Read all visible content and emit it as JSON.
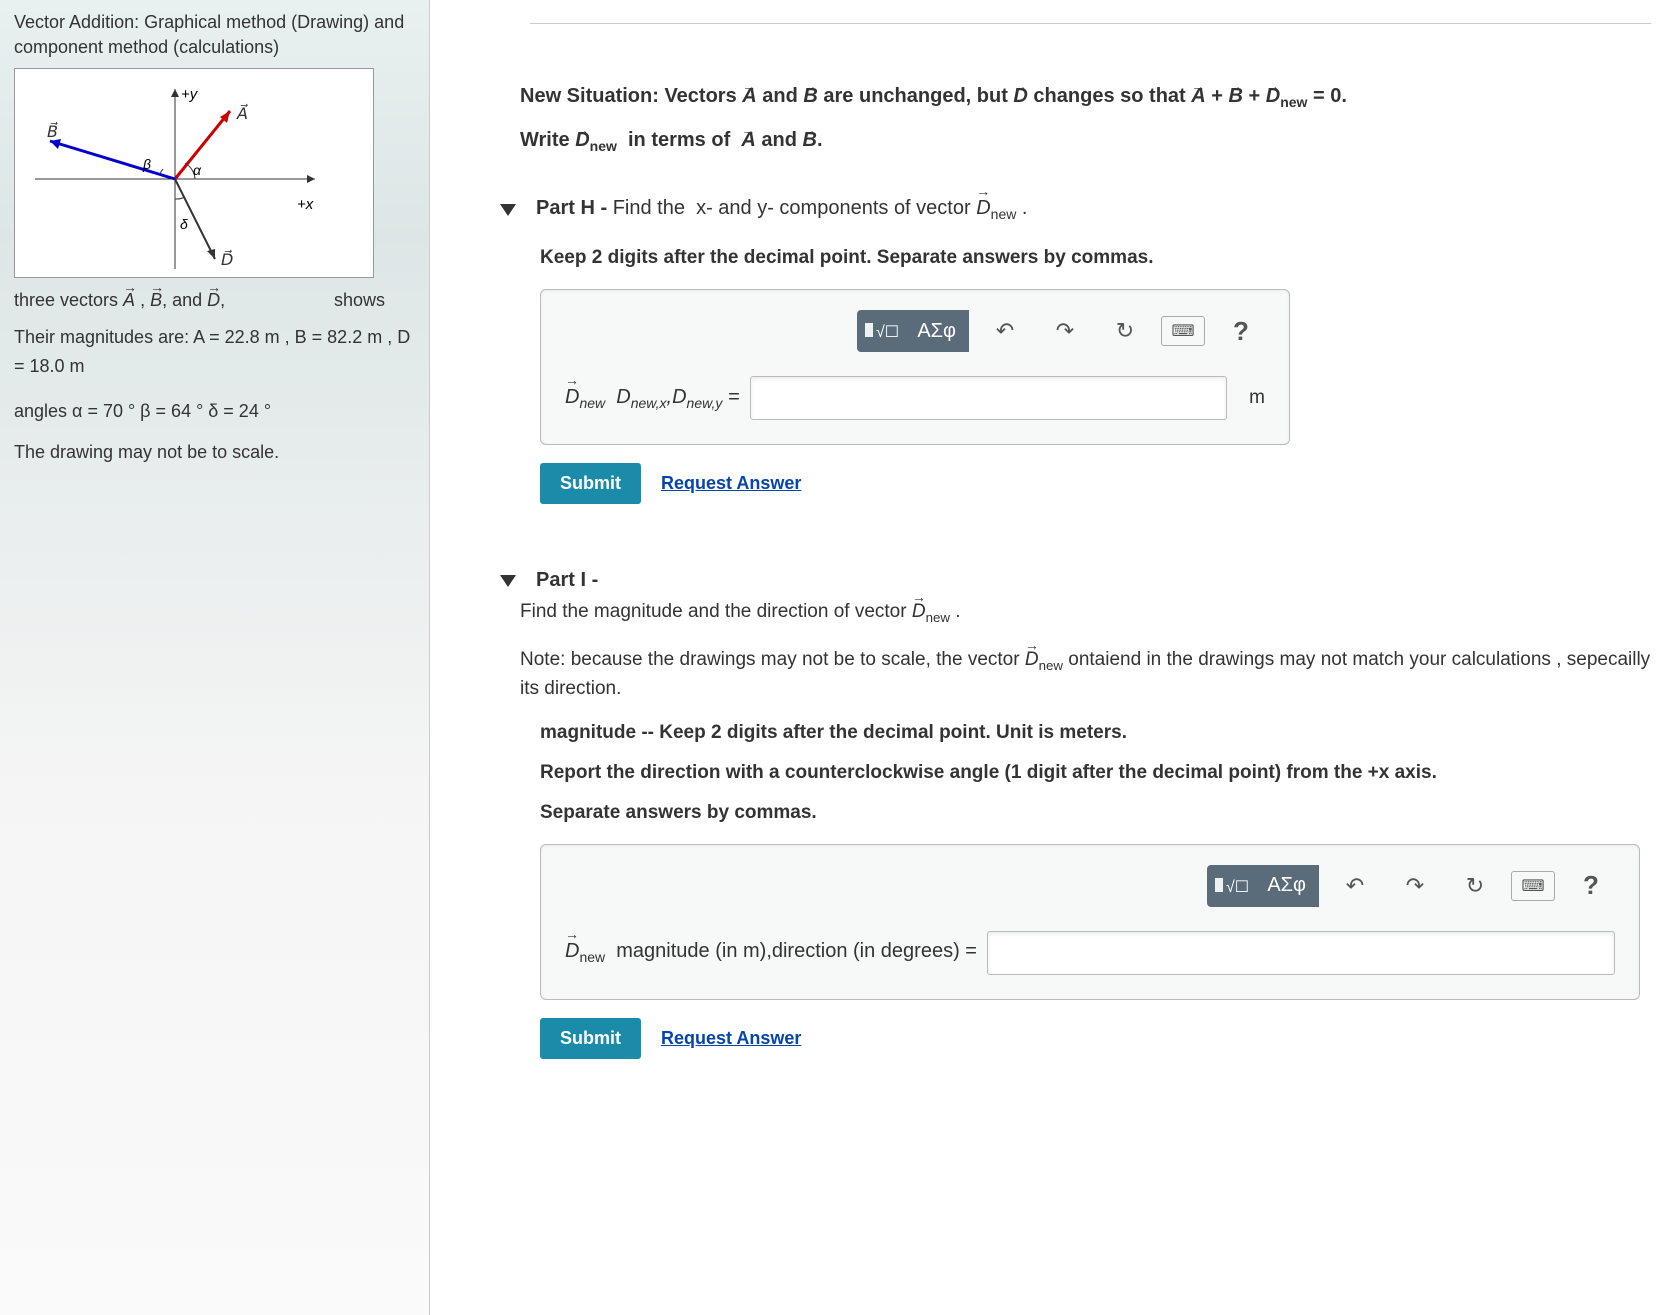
{
  "left": {
    "title": "Vector Addition: Graphical method (Drawing)  and component method (calculations)",
    "shows": "shows",
    "vectors_line_prefix": "three vectors ",
    "vectors_line_suffix": ",",
    "mag_line": "Their magnitudes are: A = 22.8 m , B = 82.2 m , D = 18.0 m",
    "angles_line": "angles α = 70 °     β = 64 °     δ = 24 °",
    "scale_note": "The drawing may not be to scale."
  },
  "diagram": {
    "labels": {
      "plus_y": "+y",
      "plus_x": "+x",
      "A": "A",
      "B": "B",
      "D": "D",
      "alpha": "α",
      "beta": "β",
      "delta": "δ"
    }
  },
  "situation": {
    "line1_html": "New Situation: Vectors A⃗ and B⃗ are unchanged, but D⃗ changes so that A⃗ + B⃗ + D⃗ₙₑw = 0.",
    "line2_html": "Write D⃗ₙₑw  in terms of  A⃗ and B⃗."
  },
  "partH": {
    "title_prefix": "Part H - ",
    "title_rest": "Find the  x- and y- components of vector D⃗ₙₑw .",
    "instr": "Keep 2 digits after the decimal point. Separate answers by commas.",
    "label_html": "D⃗ₙₑw   Dₙₑw,ₓ,Dₙₑw,ᵧ =",
    "unit": "m",
    "submit": "Submit",
    "request": "Request Answer"
  },
  "partI": {
    "title": "Part I -",
    "desc": "Find the magnitude and the direction of vector D⃗ₙₑw .",
    "note": "Note: because the drawings may not be to scale, the vector D⃗ₙₑw ontaiend in the drawings may not match your calculations , sepecailly its direction.",
    "instr1": "magnitude -- Keep 2 digits after the decimal point. Unit is meters.",
    "instr2": "Report the direction with a counterclockwise angle (1 digit after the decimal point) from the +x axis.",
    "instr3": "Separate answers by commas.",
    "label_html": "D⃗ₙₑw  magnitude (in m),direction (in degrees) =",
    "submit": "Submit",
    "request": "Request Answer"
  },
  "toolbar": {
    "sqrt": "ⁿ√☐",
    "greek": "ΑΣφ",
    "undo": "↶",
    "redo": "↷",
    "reset": "↻",
    "keyboard": "⌨",
    "help": "?"
  }
}
